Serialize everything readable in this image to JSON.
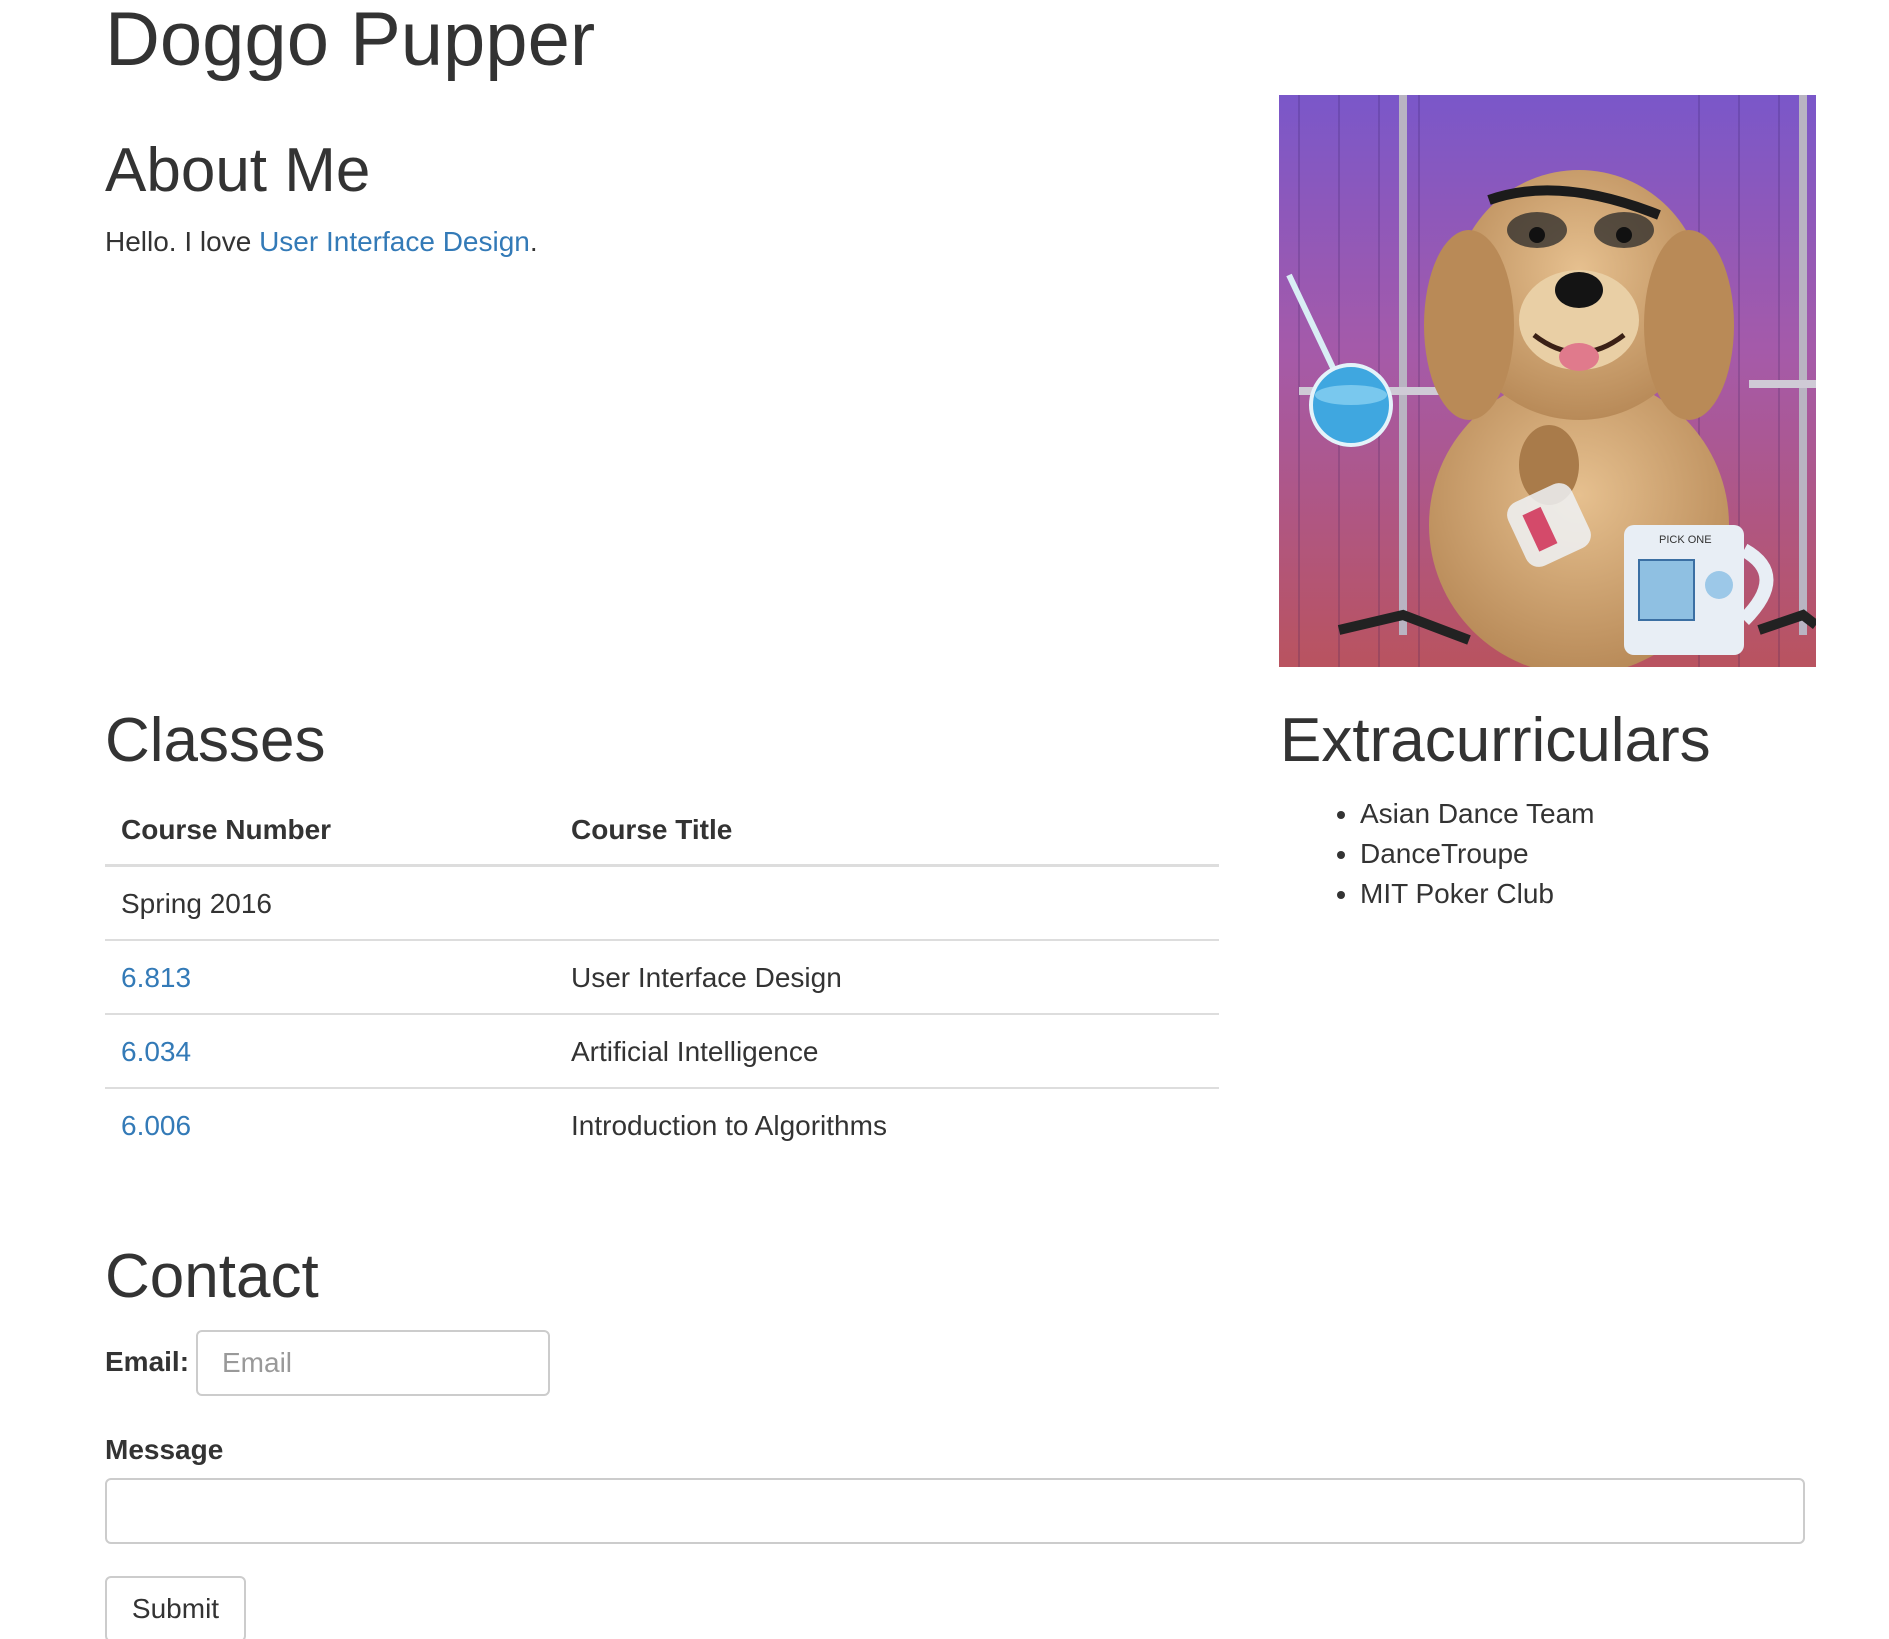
{
  "header": {
    "name": "Doggo Pupper"
  },
  "about": {
    "heading": "About Me",
    "text_before": "Hello. I love ",
    "link_text": "User Interface Design",
    "text_after": "."
  },
  "photo": {
    "icon": "dog-scientist-photo"
  },
  "classes": {
    "heading": "Classes",
    "columns": [
      "Course Number",
      "Course Title"
    ],
    "term": "Spring 2016",
    "rows": [
      {
        "number": "6.813",
        "title": "User Interface Design"
      },
      {
        "number": "6.034",
        "title": "Artificial Intelligence"
      },
      {
        "number": "6.006",
        "title": "Introduction to Algorithms"
      }
    ]
  },
  "extracurriculars": {
    "heading": "Extracurriculars",
    "items": [
      "Asian Dance Team",
      "DanceTroupe",
      "MIT Poker Club"
    ]
  },
  "contact": {
    "heading": "Contact",
    "email_label": "Email:",
    "email_placeholder": "Email",
    "message_label": "Message",
    "submit_label": "Submit"
  },
  "colors": {
    "link": "#337ab7",
    "text": "#333333",
    "border": "#dddddd"
  }
}
